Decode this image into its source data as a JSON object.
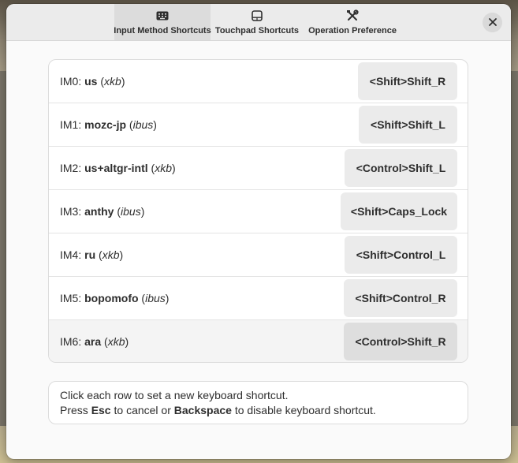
{
  "tabs": [
    {
      "label": "Input Method Shortcuts",
      "icon": "keyboard-icon",
      "active": true
    },
    {
      "label": "Touchpad Shortcuts",
      "icon": "touchpad-icon",
      "active": false
    },
    {
      "label": "Operation Preference",
      "icon": "tools-icon",
      "active": false
    }
  ],
  "close_label": "close",
  "rows": [
    {
      "prefix": "IM0: ",
      "name": "us",
      "engine": "xkb",
      "shortcut": "<Shift>Shift_R"
    },
    {
      "prefix": "IM1: ",
      "name": "mozc-jp",
      "engine": "ibus",
      "shortcut": "<Shift>Shift_L"
    },
    {
      "prefix": "IM2: ",
      "name": "us+altgr-intl",
      "engine": "xkb",
      "shortcut": "<Control>Shift_L"
    },
    {
      "prefix": "IM3: ",
      "name": "anthy",
      "engine": "ibus",
      "shortcut": "<Shift>Caps_Lock"
    },
    {
      "prefix": "IM4: ",
      "name": "ru",
      "engine": "xkb",
      "shortcut": "<Shift>Control_L"
    },
    {
      "prefix": "IM5: ",
      "name": "bopomofo",
      "engine": "ibus",
      "shortcut": "<Shift>Control_R"
    },
    {
      "prefix": "IM6: ",
      "name": "ara",
      "engine": "xkb",
      "shortcut": "<Control>Shift_R"
    }
  ],
  "info": {
    "line1": "Click each row to set a new keyboard shortcut.",
    "line2_a": "Press ",
    "line2_b": "Esc",
    "line2_c": " to cancel or ",
    "line2_d": "Backspace",
    "line2_e": " to disable keyboard shortcut."
  }
}
